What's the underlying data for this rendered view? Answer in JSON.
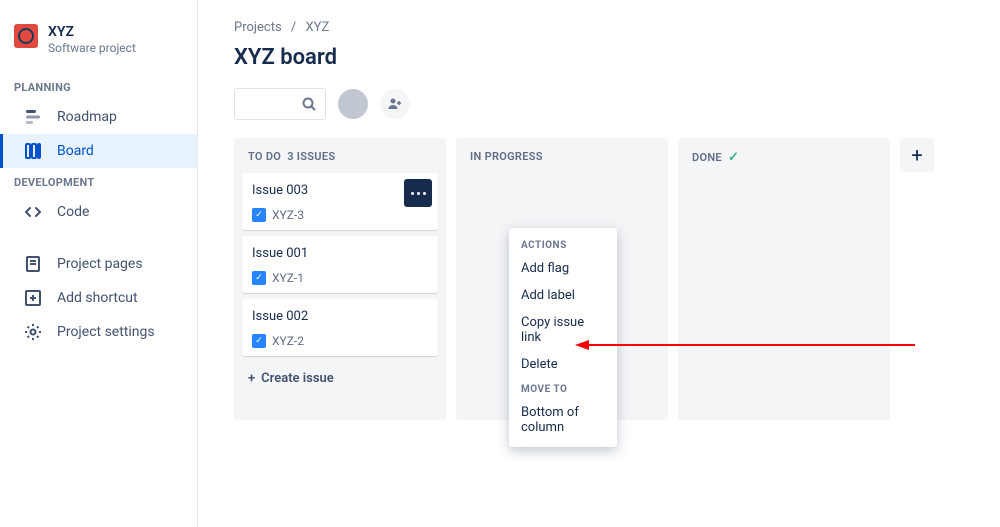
{
  "project": {
    "name": "XYZ",
    "subtitle": "Software project"
  },
  "sidebar": {
    "sections": [
      {
        "label": "PLANNING",
        "items": [
          {
            "icon": "roadmap-icon",
            "label": "Roadmap"
          },
          {
            "icon": "board-icon",
            "label": "Board",
            "active": true
          }
        ]
      },
      {
        "label": "DEVELOPMENT",
        "items": [
          {
            "icon": "code-icon",
            "label": "Code"
          }
        ]
      }
    ],
    "bottom": [
      {
        "icon": "page-icon",
        "label": "Project pages"
      },
      {
        "icon": "addshortcut-icon",
        "label": "Add shortcut"
      },
      {
        "icon": "settings-icon",
        "label": "Project settings"
      }
    ]
  },
  "breadcrumb": {
    "root": "Projects",
    "current": "XYZ"
  },
  "board_title": "XYZ board",
  "columns": {
    "todo": {
      "label": "TO DO",
      "count_label": "3 ISSUES",
      "cards": [
        {
          "title": "Issue 003",
          "key": "XYZ-3",
          "menu_open": true
        },
        {
          "title": "Issue 001",
          "key": "XYZ-1"
        },
        {
          "title": "Issue 002",
          "key": "XYZ-2"
        }
      ]
    },
    "in_progress": {
      "label": "IN PROGRESS"
    },
    "done": {
      "label": "DONE"
    }
  },
  "create_issue_label": "Create issue",
  "popover": {
    "actions_label": "ACTIONS",
    "actions": [
      "Add flag",
      "Add label",
      "Copy issue link",
      "Delete"
    ],
    "moveto_label": "MOVE TO",
    "move_targets": [
      "Bottom of column"
    ]
  }
}
